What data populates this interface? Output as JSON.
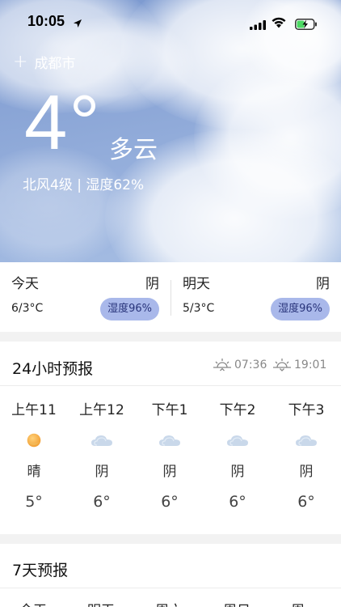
{
  "status_bar": {
    "time": "10:05"
  },
  "current": {
    "city": "成都市",
    "add_symbol": "+",
    "temperature": "4°",
    "condition": "多云",
    "details": "北风4级 | 湿度62%"
  },
  "days": [
    {
      "name": "今天",
      "weather": "阴",
      "range": "6/3°C",
      "humidity": "湿度96%"
    },
    {
      "name": "明天",
      "weather": "阴",
      "range": "5/3°C",
      "humidity": "湿度96%"
    }
  ],
  "hourly": {
    "title": "24小时预报",
    "sunrise": "07:36",
    "sunset": "19:01",
    "items": [
      {
        "time": "上午11",
        "icon": "sun-icon",
        "weather": "晴",
        "temp": "5°"
      },
      {
        "time": "上午12",
        "icon": "cloud-icon",
        "weather": "阴",
        "temp": "6°"
      },
      {
        "time": "下午1",
        "icon": "cloud-icon",
        "weather": "阴",
        "temp": "6°"
      },
      {
        "time": "下午2",
        "icon": "cloud-icon",
        "weather": "阴",
        "temp": "6°"
      },
      {
        "time": "下午3",
        "icon": "cloud-icon",
        "weather": "阴",
        "temp": "6°"
      }
    ]
  },
  "weekly": {
    "title": "7天预报",
    "days": [
      "今天",
      "明天",
      "周六",
      "周日",
      "周一"
    ]
  },
  "colors": {
    "sky": "#8aa5d6",
    "humidity_pill": "#a9b8ea",
    "humidity_text": "#28337a"
  }
}
